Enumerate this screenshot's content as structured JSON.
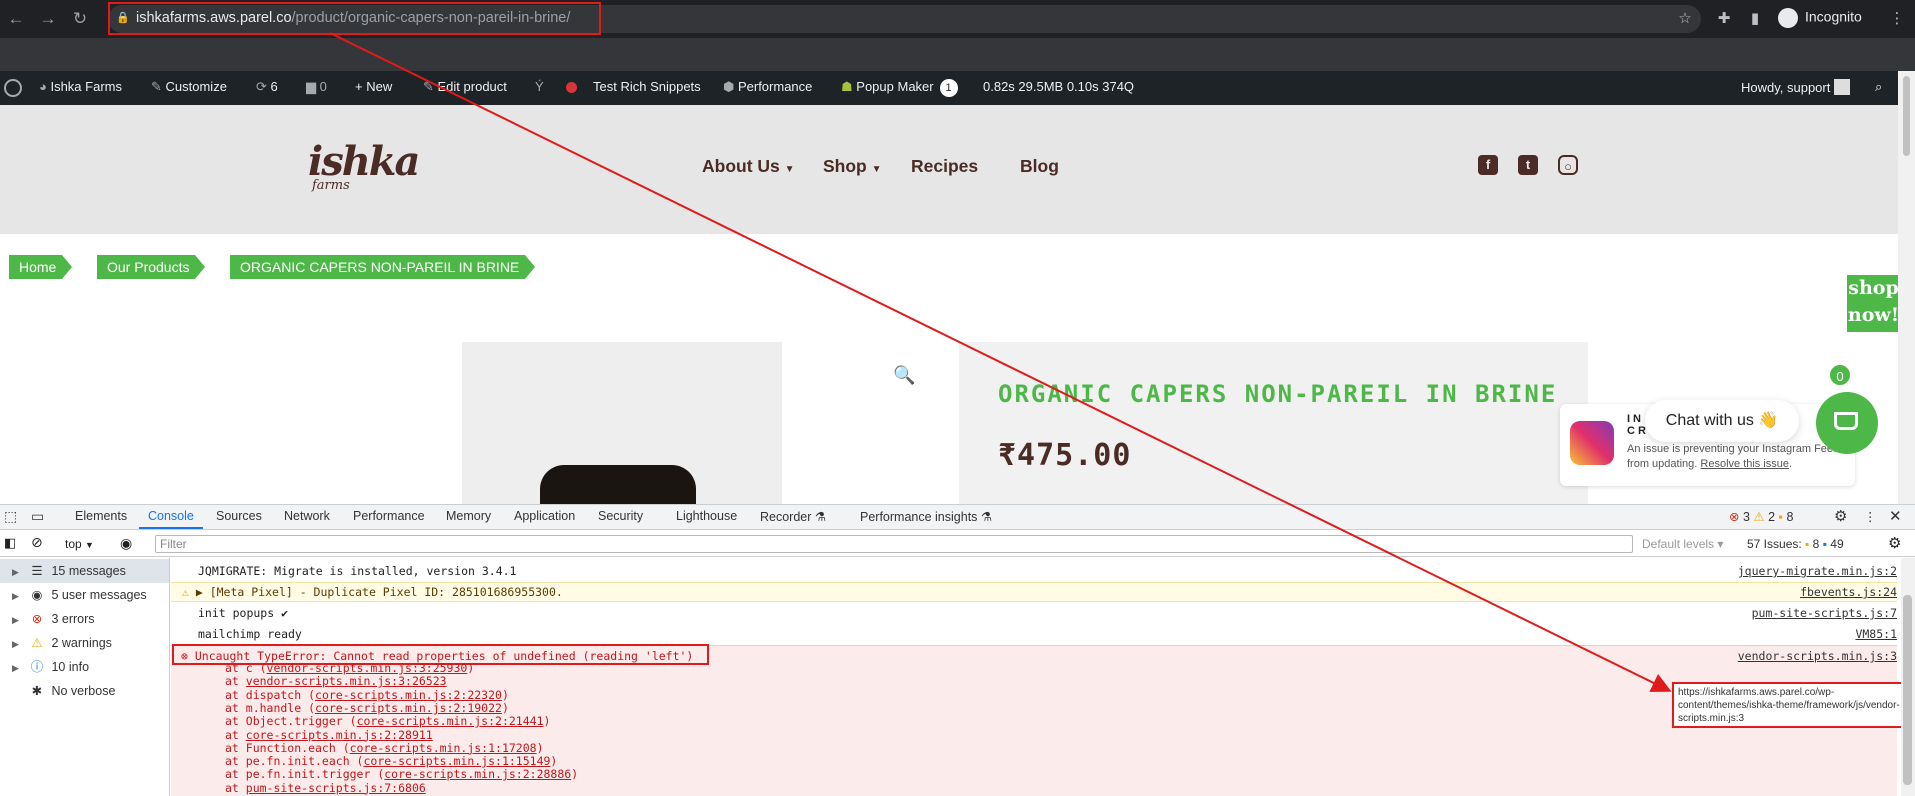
{
  "browser": {
    "url_host": "ishkafarms.aws.parel.co",
    "url_path": "/product/organic-capers-non-pareil-in-brine/",
    "profile": "Incognito"
  },
  "wpbar": {
    "site": "Ishka Farms",
    "customize": "Customize",
    "updates": "6",
    "comments": "0",
    "new": "New",
    "edit": "Edit product",
    "rich": "Test Rich Snippets",
    "performance": "Performance",
    "popup": "Popup Maker",
    "popup_count": "1",
    "stats": "0.82s  29.5MB  0.10s  374Q",
    "howdy": "Howdy, support"
  },
  "site": {
    "logo_text": "ishka",
    "logo_sub": "farms",
    "menu": [
      "About Us",
      "Shop",
      "Recipes",
      "Blog"
    ],
    "breadcrumb": [
      "Home",
      "Our Products",
      "ORGANIC CAPERS NON-PAREIL IN BRINE"
    ],
    "shop_now": [
      "shop",
      "now!"
    ],
    "product_title": "ORGANIC CAPERS NON-PAREIL IN BRINE",
    "price": "₹475.00",
    "chat": "Chat with us 👋",
    "cart_count": "0",
    "ig_title_1": "IN",
    "ig_title_2": "CR",
    "ig_msg": "An issue is preventing your Instagram Feeds from updating.",
    "ig_link": "Resolve this issue"
  },
  "devtools": {
    "tabs": [
      "Elements",
      "Console",
      "Sources",
      "Network",
      "Performance",
      "Memory",
      "Application",
      "Security",
      "Lighthouse",
      "Recorder ⚗",
      "Performance insights ⚗"
    ],
    "errors": "3",
    "warnings": "2",
    "issues_badge": "8",
    "context": "top",
    "filter_placeholder": "Filter",
    "levels": "Default levels",
    "issues_label": "57 Issues:",
    "issues_count_a": "8",
    "issues_count_b": "49",
    "sidebar": [
      "15 messages",
      "5 user messages",
      "3 errors",
      "2 warnings",
      "10 info",
      "No verbose"
    ],
    "messages": [
      {
        "text": "JQMIGRATE: Migrate is installed, version 3.4.1",
        "src": "jquery-migrate.min.js:2"
      },
      {
        "text": "▶ [Meta Pixel] - Duplicate Pixel ID: 285101686955300.",
        "src": "fbevents.js:24"
      },
      {
        "text": "init popups ✔",
        "src": "pum-site-scripts.js:7"
      },
      {
        "text": "mailchimp ready",
        "src": "VM85:1"
      },
      {
        "text": "Uncaught TypeError: Cannot read properties of undefined (reading 'left')",
        "src": "vendor-scripts.min.js:3"
      }
    ],
    "stack": [
      {
        "pre": "at c (",
        "link": "vendor-scripts.min.js:3:25930",
        "post": ")"
      },
      {
        "pre": "at ",
        "link": "vendor-scripts.min.js:3:26523",
        "post": ""
      },
      {
        "pre": "at dispatch (",
        "link": "core-scripts.min.js:2:22320",
        "post": ")"
      },
      {
        "pre": "at m.handle (",
        "link": "core-scripts.min.js:2:19022",
        "post": ")"
      },
      {
        "pre": "at Object.trigger (",
        "link": "core-scripts.min.js:2:21441",
        "post": ")"
      },
      {
        "pre": "at ",
        "link": "core-scripts.min.js:2:28911",
        "post": ""
      },
      {
        "pre": "at Function.each (",
        "link": "core-scripts.min.js:1:17208",
        "post": ")"
      },
      {
        "pre": "at pe.fn.init.each (",
        "link": "core-scripts.min.js:1:15149",
        "post": ")"
      },
      {
        "pre": "at pe.fn.init.trigger (",
        "link": "core-scripts.min.js:2:28886",
        "post": ")"
      },
      {
        "pre": "at ",
        "link": "pum-site-scripts.js:7:6806",
        "post": ""
      }
    ],
    "tooltip": "https://ishkafarms.aws.parel.co/wp-content/themes/ishka-theme/framework/js/vendor-scripts.min.js:3"
  },
  "colors": {
    "accent_green": "#4db848",
    "brand_brown": "#4a2b25",
    "annotation_red": "#e01b1b"
  }
}
